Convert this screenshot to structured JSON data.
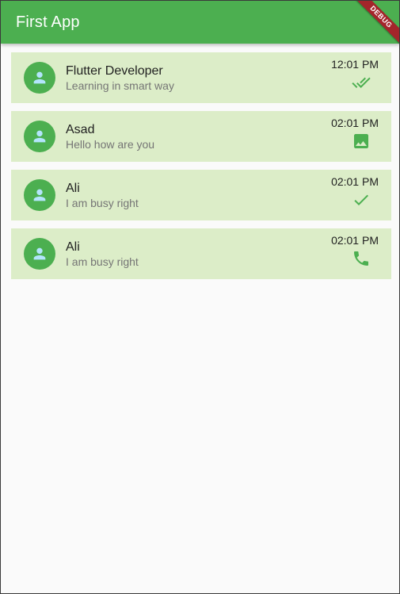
{
  "appbar": {
    "title": "First App",
    "color": "#4caf50"
  },
  "debug_banner": {
    "label": "DEBUG"
  },
  "chats": [
    {
      "name": "Flutter Developer",
      "message": "Learning in smart way",
      "time": "12:01 PM",
      "status_icon": "done-all-icon"
    },
    {
      "name": "Asad",
      "message": "Hello how are you",
      "time": "02:01 PM",
      "status_icon": "image-icon"
    },
    {
      "name": "Ali",
      "message": "I am busy right",
      "time": "02:01 PM",
      "status_icon": "check-icon"
    },
    {
      "name": "Ali",
      "message": "I am busy right",
      "time": "02:01 PM",
      "status_icon": "phone-icon"
    }
  ],
  "colors": {
    "primary": "#4caf50",
    "card": "#dcedc8",
    "avatar_icon": "#b3e5fc"
  }
}
